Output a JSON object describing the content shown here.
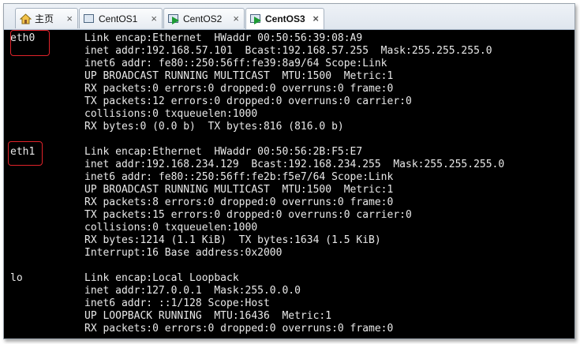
{
  "tabs": [
    {
      "label": "主页",
      "icon": "home-icon"
    },
    {
      "label": "CentOS1",
      "icon": "vm-icon"
    },
    {
      "label": "CentOS2",
      "icon": "vm-powered-on-icon"
    },
    {
      "label": "CentOS3",
      "icon": "vm-powered-on-icon",
      "active": true
    }
  ],
  "close_glyph": "×",
  "terminal": {
    "eth0": {
      "name": "eth0",
      "lines": [
        "Link encap:Ethernet  HWaddr 00:50:56:39:08:A9",
        "inet addr:192.168.57.101  Bcast:192.168.57.255  Mask:255.255.255.0",
        "inet6 addr: fe80::250:56ff:fe39:8a9/64 Scope:Link",
        "UP BROADCAST RUNNING MULTICAST  MTU:1500  Metric:1",
        "RX packets:0 errors:0 dropped:0 overruns:0 frame:0",
        "TX packets:12 errors:0 dropped:0 overruns:0 carrier:0",
        "collisions:0 txqueuelen:1000",
        "RX bytes:0 (0.0 b)  TX bytes:816 (816.0 b)"
      ]
    },
    "eth1": {
      "name": "eth1",
      "lines": [
        "Link encap:Ethernet  HWaddr 00:50:56:2B:F5:E7",
        "inet addr:192.168.234.129  Bcast:192.168.234.255  Mask:255.255.255.0",
        "inet6 addr: fe80::250:56ff:fe2b:f5e7/64 Scope:Link",
        "UP BROADCAST RUNNING MULTICAST  MTU:1500  Metric:1",
        "RX packets:8 errors:0 dropped:0 overruns:0 frame:0",
        "TX packets:15 errors:0 dropped:0 overruns:0 carrier:0",
        "collisions:0 txqueuelen:1000",
        "RX bytes:1214 (1.1 KiB)  TX bytes:1634 (1.5 KiB)",
        "Interrupt:16 Base address:0x2000"
      ]
    },
    "lo": {
      "name": "lo",
      "lines": [
        "Link encap:Local Loopback",
        "inet addr:127.0.0.1  Mask:255.0.0.0",
        "inet6 addr: ::1/128 Scope:Host",
        "UP LOOPBACK RUNNING  MTU:16436  Metric:1",
        "RX packets:0 errors:0 dropped:0 overruns:0 frame:0"
      ]
    }
  },
  "colors": {
    "terminal_bg": "#000000",
    "terminal_fg": "#e8e8e8",
    "highlight_box": "#e0232a",
    "play_green": "#1d9a35"
  }
}
